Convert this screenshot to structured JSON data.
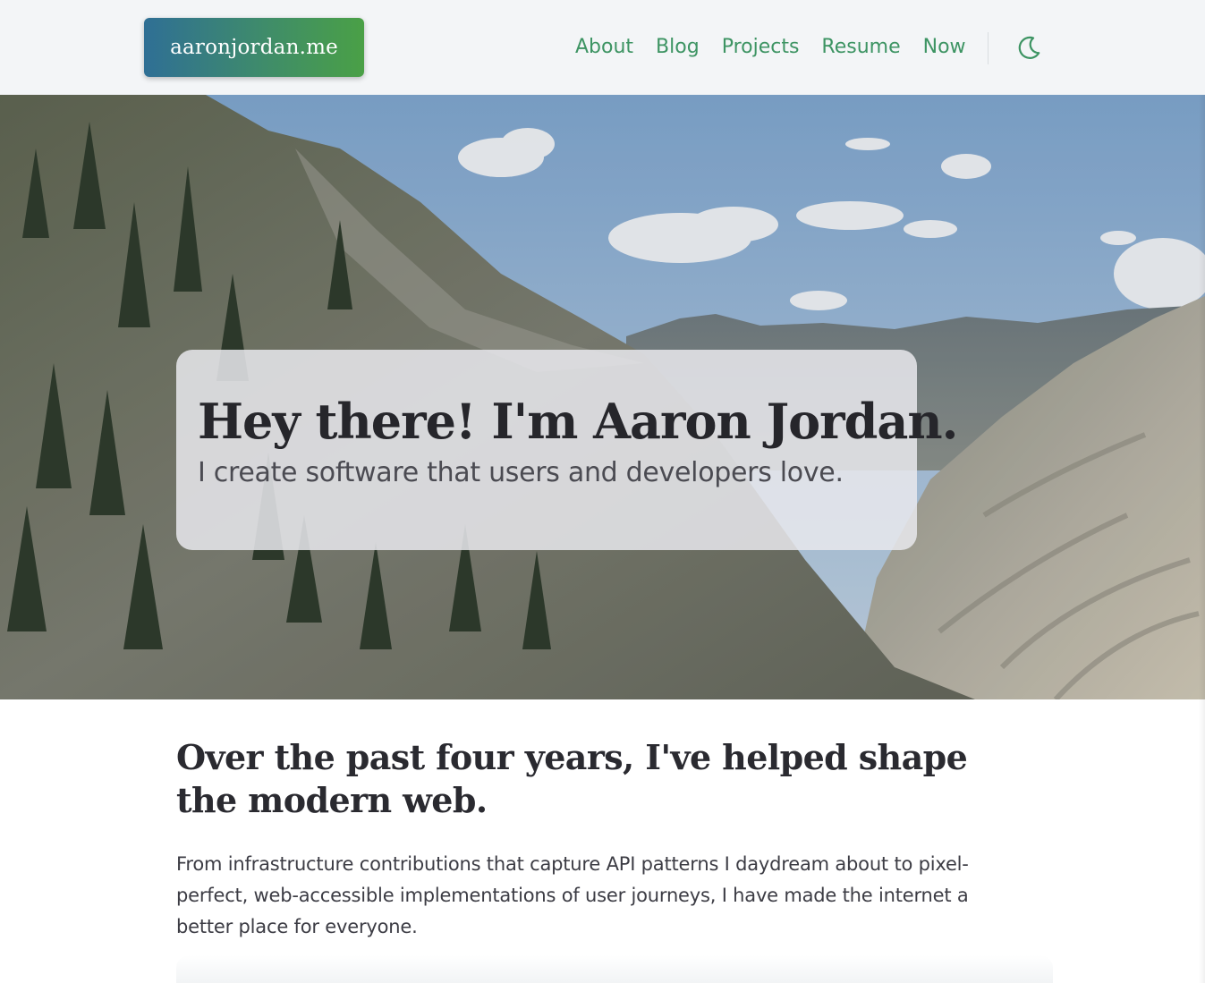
{
  "site": {
    "logo_text": "aaronjordan.me"
  },
  "nav": {
    "items": [
      {
        "label": "About"
      },
      {
        "label": "Blog"
      },
      {
        "label": "Projects"
      },
      {
        "label": "Resume"
      },
      {
        "label": "Now"
      }
    ],
    "theme_toggle_icon": "moon-icon"
  },
  "hero": {
    "title": "Hey there! I'm Aaron Jordan.",
    "subtitle": "I create software that users and developers love.",
    "background_image": "mountain-valley-photo"
  },
  "intro": {
    "heading": "Over the past four years, I've helped shape the modern web.",
    "body": "From infrastructure contributions that capture API patterns I daydream about to pixel-perfect, web-accessible implementations of user journeys, I have made the internet a better place for everyone."
  },
  "colors": {
    "accent": "#3d9463",
    "logo_gradient_start": "#2f6f95",
    "logo_gradient_end": "#4aa046",
    "header_bg": "#f3f5f7",
    "text": "#2a2a2e"
  }
}
